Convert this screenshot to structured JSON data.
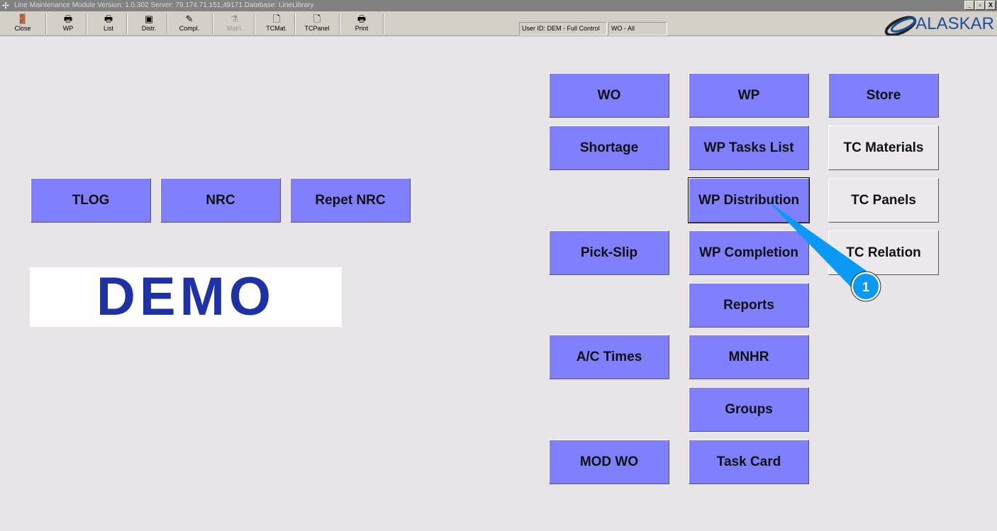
{
  "window": {
    "title": "Line Maintenance Module  Version: 1.0.302 Server: 79.174.71.151,49171 Database: LineLibrary",
    "controls": [
      "_",
      "▫",
      "X"
    ]
  },
  "toolbar": [
    {
      "label": "Close",
      "icon": "door-exit-icon",
      "glyph": "🚪",
      "enabled": true
    },
    {
      "label": "WP",
      "icon": "printer-icon",
      "glyph": "🖶",
      "enabled": true
    },
    {
      "label": "List",
      "icon": "printer-icon",
      "glyph": "🖶",
      "enabled": true
    },
    {
      "label": "Distr.",
      "icon": "distribution-icon",
      "glyph": "▣",
      "enabled": true
    },
    {
      "label": "Compl.",
      "icon": "completion-icon",
      "glyph": "✎",
      "enabled": true
    },
    {
      "label": "Matrl.",
      "icon": "flask-icon",
      "glyph": "⚗",
      "enabled": false
    },
    {
      "label": "TCMat.",
      "icon": "document-icon",
      "glyph": "🗋",
      "enabled": true
    },
    {
      "label": "TCPanel",
      "icon": "document-icon",
      "glyph": "🗋",
      "enabled": true
    },
    {
      "label": "Print",
      "icon": "printer-icon",
      "glyph": "🖶",
      "enabled": true
    }
  ],
  "status": {
    "user": "User ID: DEM - Full Control",
    "wo": "WO - All"
  },
  "logo": {
    "text": "ALASKAR"
  },
  "left_buttons": [
    "TLOG",
    "NRC",
    "Repet NRC"
  ],
  "demo": "DEMO",
  "col1": {
    "wo": "WO",
    "shortage": "Shortage",
    "pickslip": "Pick-Slip",
    "actimes": "A/C Times",
    "modwo": "MOD WO"
  },
  "col2": [
    "WP",
    "WP Tasks List",
    "WP Distribution",
    "WP Completion",
    "Reports",
    "MNHR",
    "Groups",
    "Task Card"
  ],
  "col3": [
    "Store",
    "TC Materials",
    "TC Panels",
    "TC Relation"
  ],
  "callout": {
    "number": "1"
  },
  "colors": {
    "button": "#8080ff",
    "background": "#e8e4e8",
    "callout": "#0a9af5"
  }
}
